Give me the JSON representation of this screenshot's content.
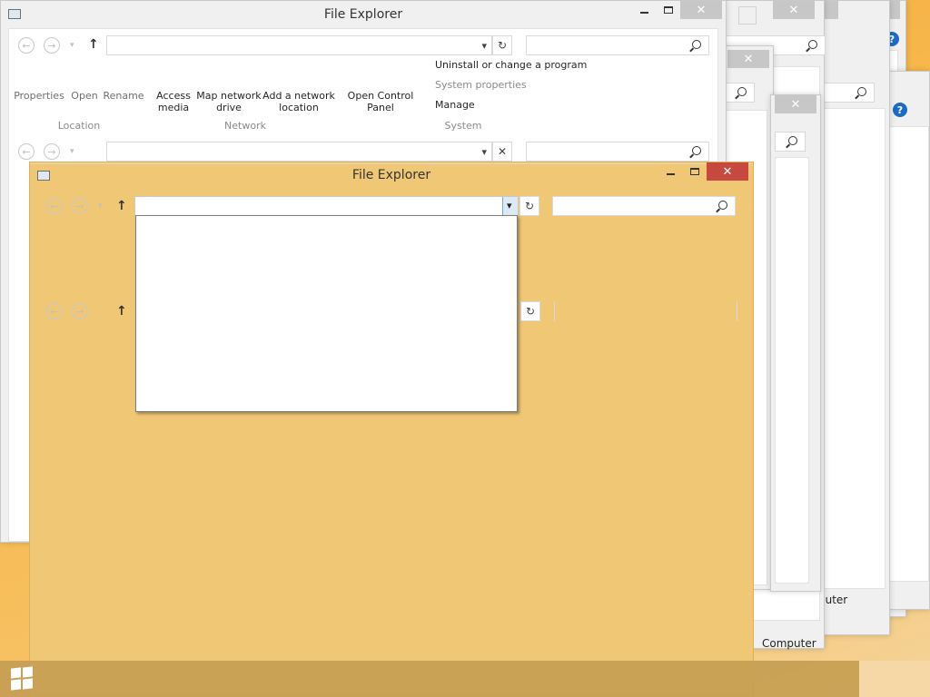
{
  "windows": {
    "background_title": "File Explorer",
    "active_title": "File Explorer",
    "close_glyph": "✕"
  },
  "ribbon": {
    "location_items": [
      "Properties",
      "Open",
      "Rename"
    ],
    "network_items": [
      "Access media",
      "Map network drive",
      "Add a network location"
    ],
    "open_control_panel": "Open Control Panel",
    "system_items": [
      "Uninstall or change a program",
      "System properties",
      "Manage"
    ],
    "groups": {
      "location": "Location",
      "network": "Network",
      "system": "System"
    }
  },
  "status": {
    "computer_label_1": "Computer",
    "computer_label_2": "puter"
  },
  "icons": {
    "back": "←",
    "forward": "→",
    "up": "↑",
    "refresh": "↻",
    "dropdown": "▾",
    "clear": "✕",
    "help": "?"
  },
  "colors": {
    "active_frame": "#f0c775",
    "close_active": "#c7483f",
    "taskbar": "#c69e52"
  }
}
